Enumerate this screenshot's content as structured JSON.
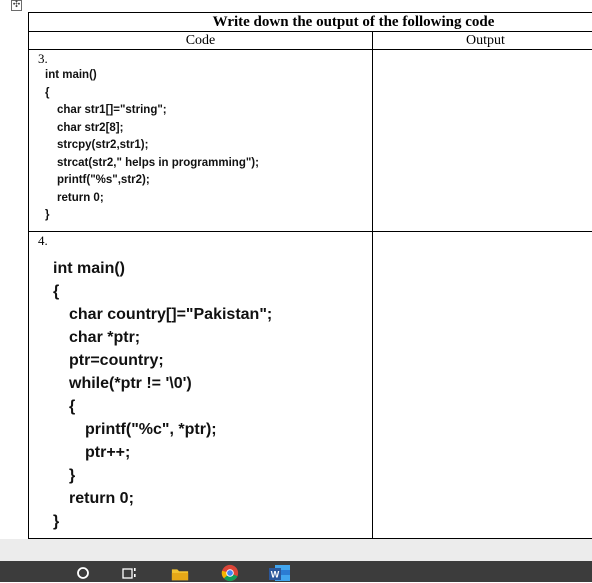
{
  "document": {
    "title": "Write down the output of the following code",
    "col_code": "Code",
    "col_output": "Output",
    "questions": [
      {
        "number": "3.",
        "lines": [
          "int main()",
          "{",
          "char str1[]=\"string\";",
          "char str2[8];",
          "strcpy(str2,str1);",
          "strcat(str2,\" helps in programming\");",
          "printf(\"%s\",str2);",
          "return 0;",
          "}"
        ],
        "output": ""
      },
      {
        "number": "4.",
        "lines": [
          "int main()",
          "{",
          "char country[]=\"Pakistan\";",
          "char *ptr;",
          "ptr=country;",
          "while(*ptr != '\\0')",
          "{",
          "printf(\"%c\", *ptr);",
          "ptr++;",
          "}",
          "return 0;",
          "}"
        ],
        "output": ""
      }
    ]
  },
  "taskbar": {
    "icons": [
      "search-icon",
      "task-view-icon",
      "file-explorer-icon",
      "chrome-icon",
      "word-icon"
    ],
    "word_label": "W"
  },
  "colors": {
    "taskbar": "#3c3c3c",
    "folder": "#f2c230",
    "word_blue": "#2b579a"
  }
}
